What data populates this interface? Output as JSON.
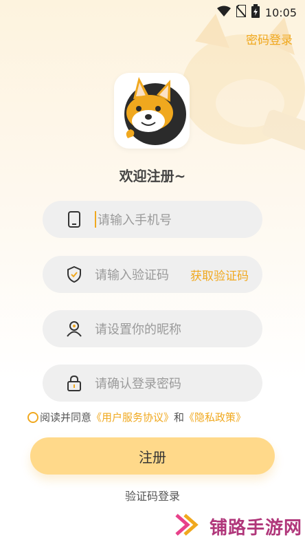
{
  "status_bar": {
    "time": "10:05"
  },
  "header": {
    "password_login_link": "密码登录"
  },
  "welcome": "欢迎注册~",
  "fields": {
    "phone": {
      "placeholder": "请输入手机号"
    },
    "code": {
      "placeholder": "请输入验证码",
      "action": "获取验证码"
    },
    "nickname": {
      "placeholder": "请设置你的昵称"
    },
    "password": {
      "placeholder": "请确认登录密码"
    }
  },
  "agreement": {
    "prefix": "阅读并同意",
    "user_agreement": "《用户服务协议》",
    "conjunction": "和",
    "privacy": "《隐私政策》"
  },
  "register_button": "注册",
  "code_login_link": "验证码登录",
  "watermark": "铺路手游网",
  "colors": {
    "accent": "#F0A81E",
    "button": "#FFD98A",
    "field_bg": "#EFEFEF"
  },
  "icons": [
    "wifi-icon",
    "no-sim-icon",
    "battery-icon",
    "phone-icon",
    "shield-icon",
    "user-icon",
    "lock-icon"
  ]
}
